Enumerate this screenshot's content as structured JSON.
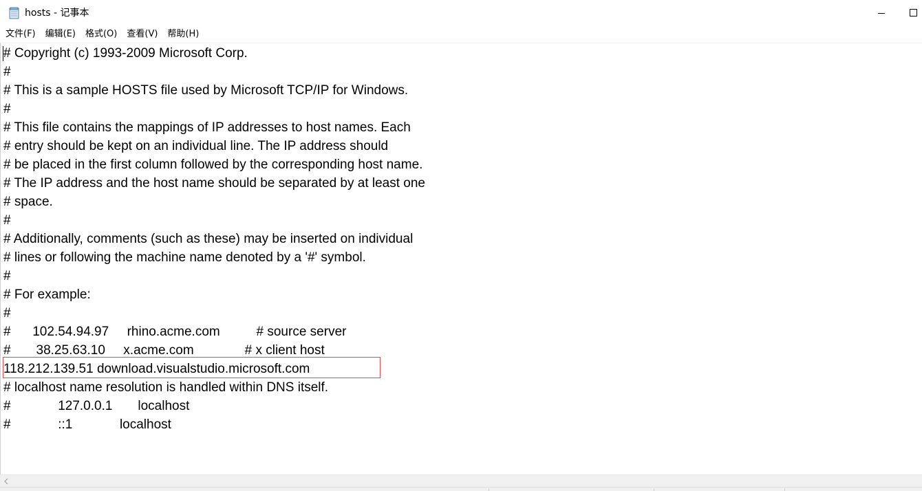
{
  "window": {
    "title": "hosts - 记事本"
  },
  "menu": {
    "items": [
      "文件(F)",
      "编辑(E)",
      "格式(O)",
      "查看(V)",
      "帮助(H)"
    ]
  },
  "icons": {
    "app": "notepad-icon",
    "minimize": "minimize-icon",
    "maximize": "maximize-icon",
    "scroll_left": "chevron-left-icon"
  },
  "colors": {
    "highlight_border": "#e14b4b"
  },
  "editor": {
    "lines": [
      "# Copyright (c) 1993-2009 Microsoft Corp.",
      "#",
      "# This is a sample HOSTS file used by Microsoft TCP/IP for Windows.",
      "#",
      "# This file contains the mappings of IP addresses to host names. Each",
      "# entry should be kept on an individual line. The IP address should",
      "# be placed in the first column followed by the corresponding host name.",
      "# The IP address and the host name should be separated by at least one",
      "# space.",
      "#",
      "# Additionally, comments (such as these) may be inserted on individual",
      "# lines or following the machine name denoted by a '#' symbol.",
      "#",
      "# For example:",
      "#",
      "#      102.54.94.97     rhino.acme.com          # source server",
      "#       38.25.63.10     x.acme.com              # x client host",
      "118.212.139.51 download.visualstudio.microsoft.com",
      "# localhost name resolution is handled within DNS itself.",
      "#             127.0.0.1       localhost",
      "#             ::1             localhost"
    ]
  }
}
